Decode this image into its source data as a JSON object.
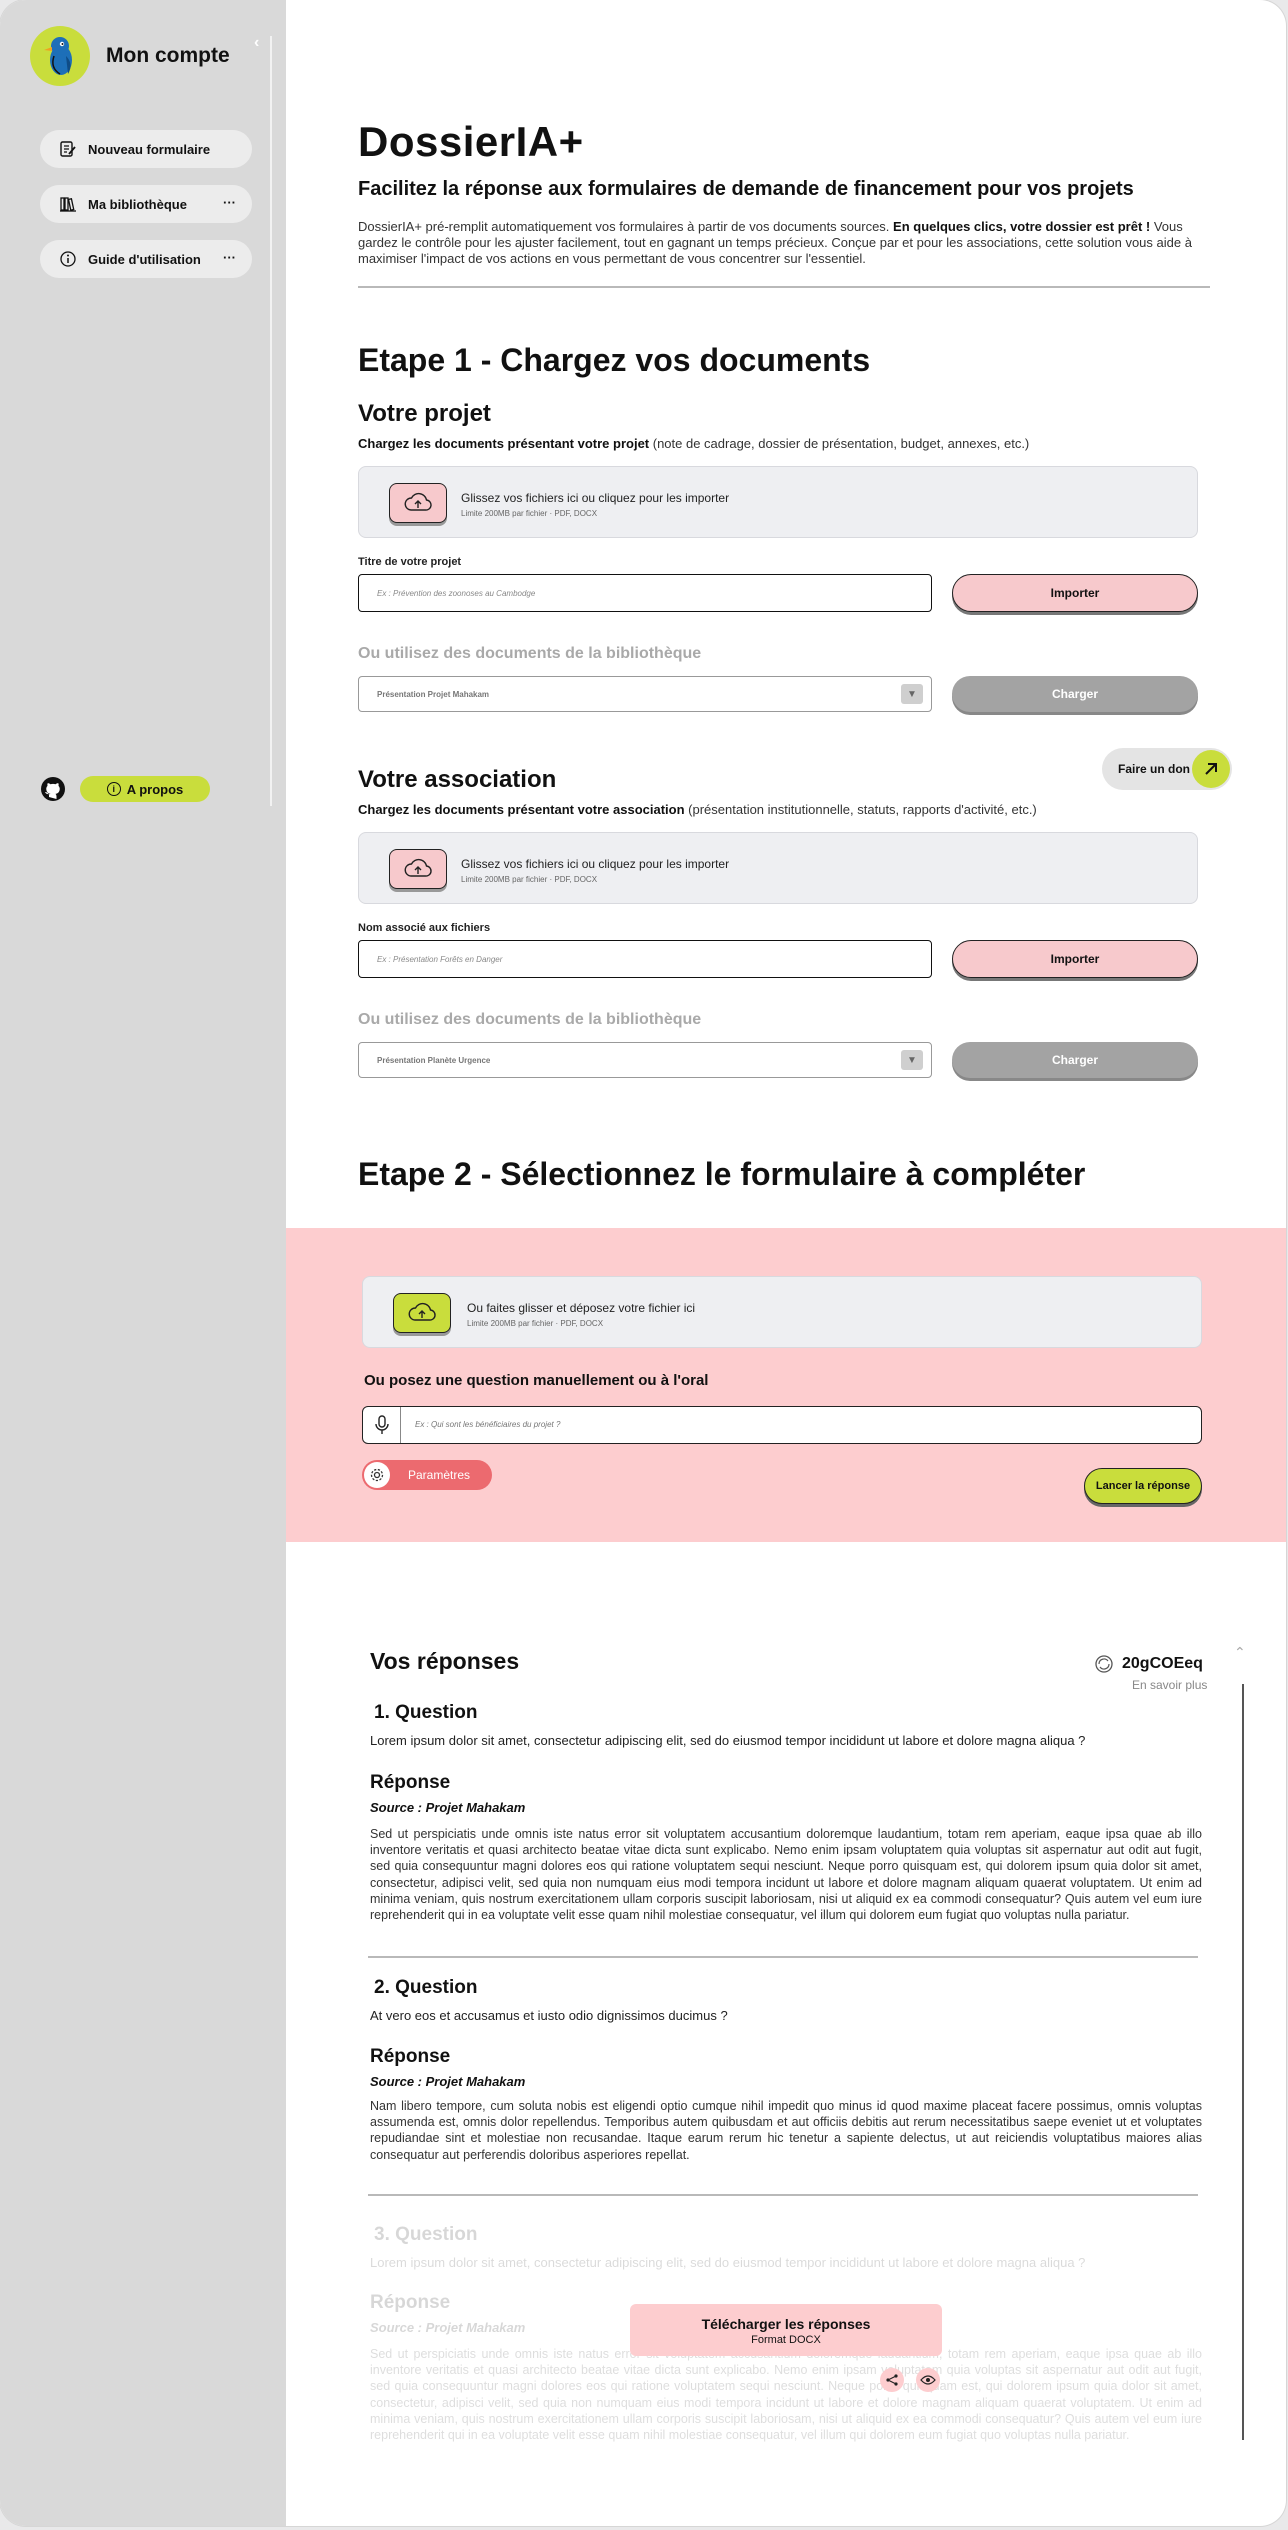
{
  "sidebar": {
    "account_name": "Mon compte",
    "collapse_glyph": "‹",
    "items": [
      {
        "label": "Nouveau formulaire",
        "icon": "edit-form-icon"
      },
      {
        "label": "Ma bibliothèque",
        "icon": "library-icon",
        "more": "···"
      },
      {
        "label": "Guide d'utilisation",
        "icon": "guide-icon",
        "more": "···"
      }
    ],
    "about_label": "A propos"
  },
  "header": {
    "title": "DossierIA+",
    "subtitle": "Facilitez la réponse aux formulaires de demande de financement pour vos projets",
    "desc_part1": "DossierIA+ pré-remplit automatiquement vos formulaires à partir de vos documents sources. ",
    "desc_bold": "En quelques clics, votre dossier est prêt !",
    "desc_part2": " Vous gardez le contrôle pour les ajuster facilement, tout en gagnant un temps précieux. Conçue par et pour les associations, cette solution vous aide à maximiser l'impact de vos actions en vous permettant de vous concentrer sur l'essentiel."
  },
  "step1": {
    "title": "Etape 1 - Chargez vos documents",
    "project": {
      "title": "Votre projet",
      "desc_bold": "Chargez les documents présentant votre projet",
      "desc_rest": " (note de cadrage, dossier de présentation, budget, annexes, etc.)",
      "dropzone_text": "Glissez vos fichiers ici ou cliquez pour les importer",
      "dropzone_sub": "Limite 200MB par fichier · PDF, DOCX",
      "field_label": "Titre de votre projet",
      "placeholder": "Ex : Prévention des zoonoses au Cambodge",
      "import_label": "Importer",
      "lib_title": "Ou utilisez des documents de la bibliothèque",
      "select_value": "Présentation Projet Mahakam",
      "load_label": "Charger"
    },
    "association": {
      "title": "Votre association",
      "desc_bold": "Chargez les documents présentant votre association",
      "desc_rest": " (présentation institutionnelle, statuts, rapports d'activité, etc.)",
      "dropzone_text": "Glissez vos fichiers ici ou cliquez pour les importer",
      "dropzone_sub": "Limite 200MB par fichier · PDF, DOCX",
      "field_label": "Nom associé aux fichiers",
      "placeholder": "Ex : Présentation Forêts en Danger",
      "import_label": "Importer",
      "lib_title": "Ou utilisez des documents de la bibliothèque",
      "select_value": "Présentation Planète Urgence",
      "load_label": "Charger"
    },
    "donate_label": "Faire un don"
  },
  "step2": {
    "title": "Etape 2 - Sélectionnez le formulaire à compléter",
    "dropzone_text": "Ou faites glisser et déposez votre fichier ici",
    "dropzone_sub": "Limite 200MB par fichier · PDF, DOCX",
    "question_title": "Ou posez une question manuellement ou à l'oral",
    "question_placeholder": "Ex : Qui sont les bénéficiaires du projet ?",
    "params_label": "Paramètres",
    "launch_label": "Lancer la réponse"
  },
  "responses": {
    "title": "Vos réponses",
    "token_value": "20gCOEeq",
    "learn_more": "En savoir plus",
    "items": [
      {
        "num": "1. Question",
        "question": "Lorem ipsum dolor sit amet, consectetur adipiscing elit, sed do eiusmod tempor incididunt ut labore et dolore magna aliqua ?",
        "answer_title": "Réponse",
        "source": "Source : Projet Mahakam",
        "answer": "Sed ut perspiciatis unde omnis iste natus error sit voluptatem  accusantium doloremque laudantium, totam rem aperiam, eaque ipsa quae ab illo inventore veritatis et quasi architecto beatae vitae dicta sunt  explicabo. Nemo enim ipsam voluptatem quia voluptas sit aspernatur aut  odit aut fugit, sed quia consequuntur magni dolores eos qui ratione  voluptatem sequi nesciunt. Neque porro quisquam est, qui dolorem ipsum  quia dolor sit amet, consectetur, adipisci velit, sed quia non numquam  eius modi tempora incidunt ut labore et dolore magnam aliquam quaerat  voluptatem. Ut enim ad minima veniam, quis nostrum exercitationem ullam  corporis suscipit laboriosam, nisi ut aliquid ex ea commodi consequatur? Quis autem vel eum iure reprehenderit qui in ea voluptate velit esse  quam nihil molestiae consequatur, vel illum qui dolorem eum fugiat quo  voluptas nulla pariatur."
      },
      {
        "num": "2. Question",
        "question": "At vero eos et accusamus et iusto odio dignissimos ducimus ?",
        "answer_title": "Réponse",
        "source": "Source : Projet Mahakam",
        "answer": "Nam libero tempore, cum soluta nobis est eligendi optio cumque nihil  impedit quo minus id quod maxime placeat facere possimus, omnis voluptas assumenda est, omnis dolor repellendus. Temporibus autem quibusdam et  aut officiis debitis aut rerum necessitatibus saepe eveniet ut et  voluptates repudiandae sint et molestiae non recusandae. Itaque earum  rerum hic tenetur a sapiente delectus, ut aut reiciendis voluptatibus  maiores alias consequatur aut perferendis doloribus asperiores repellat."
      },
      {
        "num": "3. Question",
        "question": "Lorem ipsum dolor sit amet, consectetur adipiscing elit, sed do eiusmod tempor incididunt ut labore et dolore magna aliqua ?",
        "answer_title": "Réponse",
        "source": "Source : Projet Mahakam",
        "answer": "Sed ut perspiciatis unde omnis iste natus error sit voluptatem  accusantium doloremque laudantium, totam rem aperiam, eaque ipsa quae ab illo inventore veritatis et quasi architecto beatae vitae dicta sunt  explicabo. Nemo enim ipsam voluptatem quia voluptas sit aspernatur aut  odit aut fugit, sed quia consequuntur magni dolores eos qui ratione  voluptatem sequi nesciunt. Neque porro quisquam est, qui dolorem ipsum  quia dolor sit amet, consectetur, adipisci velit, sed quia non numquam  eius modi tempora incidunt ut labore et dolore magnam aliquam quaerat  voluptatem. Ut enim ad minima veniam, quis nostrum exercitationem ullam  corporis suscipit laboriosam, nisi ut aliquid ex ea commodi consequatur? Quis autem vel eum iure reprehenderit qui in ea voluptate velit esse  quam nihil molestiae consequatur, vel illum qui dolorem eum fugiat quo  voluptas nulla pariatur."
      }
    ],
    "download_title": "Télécharger les réponses",
    "download_format": "Format DOCX"
  },
  "colors": {
    "accent_green": "#c9dd3c",
    "accent_pink": "#fdcdcf",
    "params_red": "#ec6a6f",
    "sidebar_gray": "#d9d9d9"
  }
}
